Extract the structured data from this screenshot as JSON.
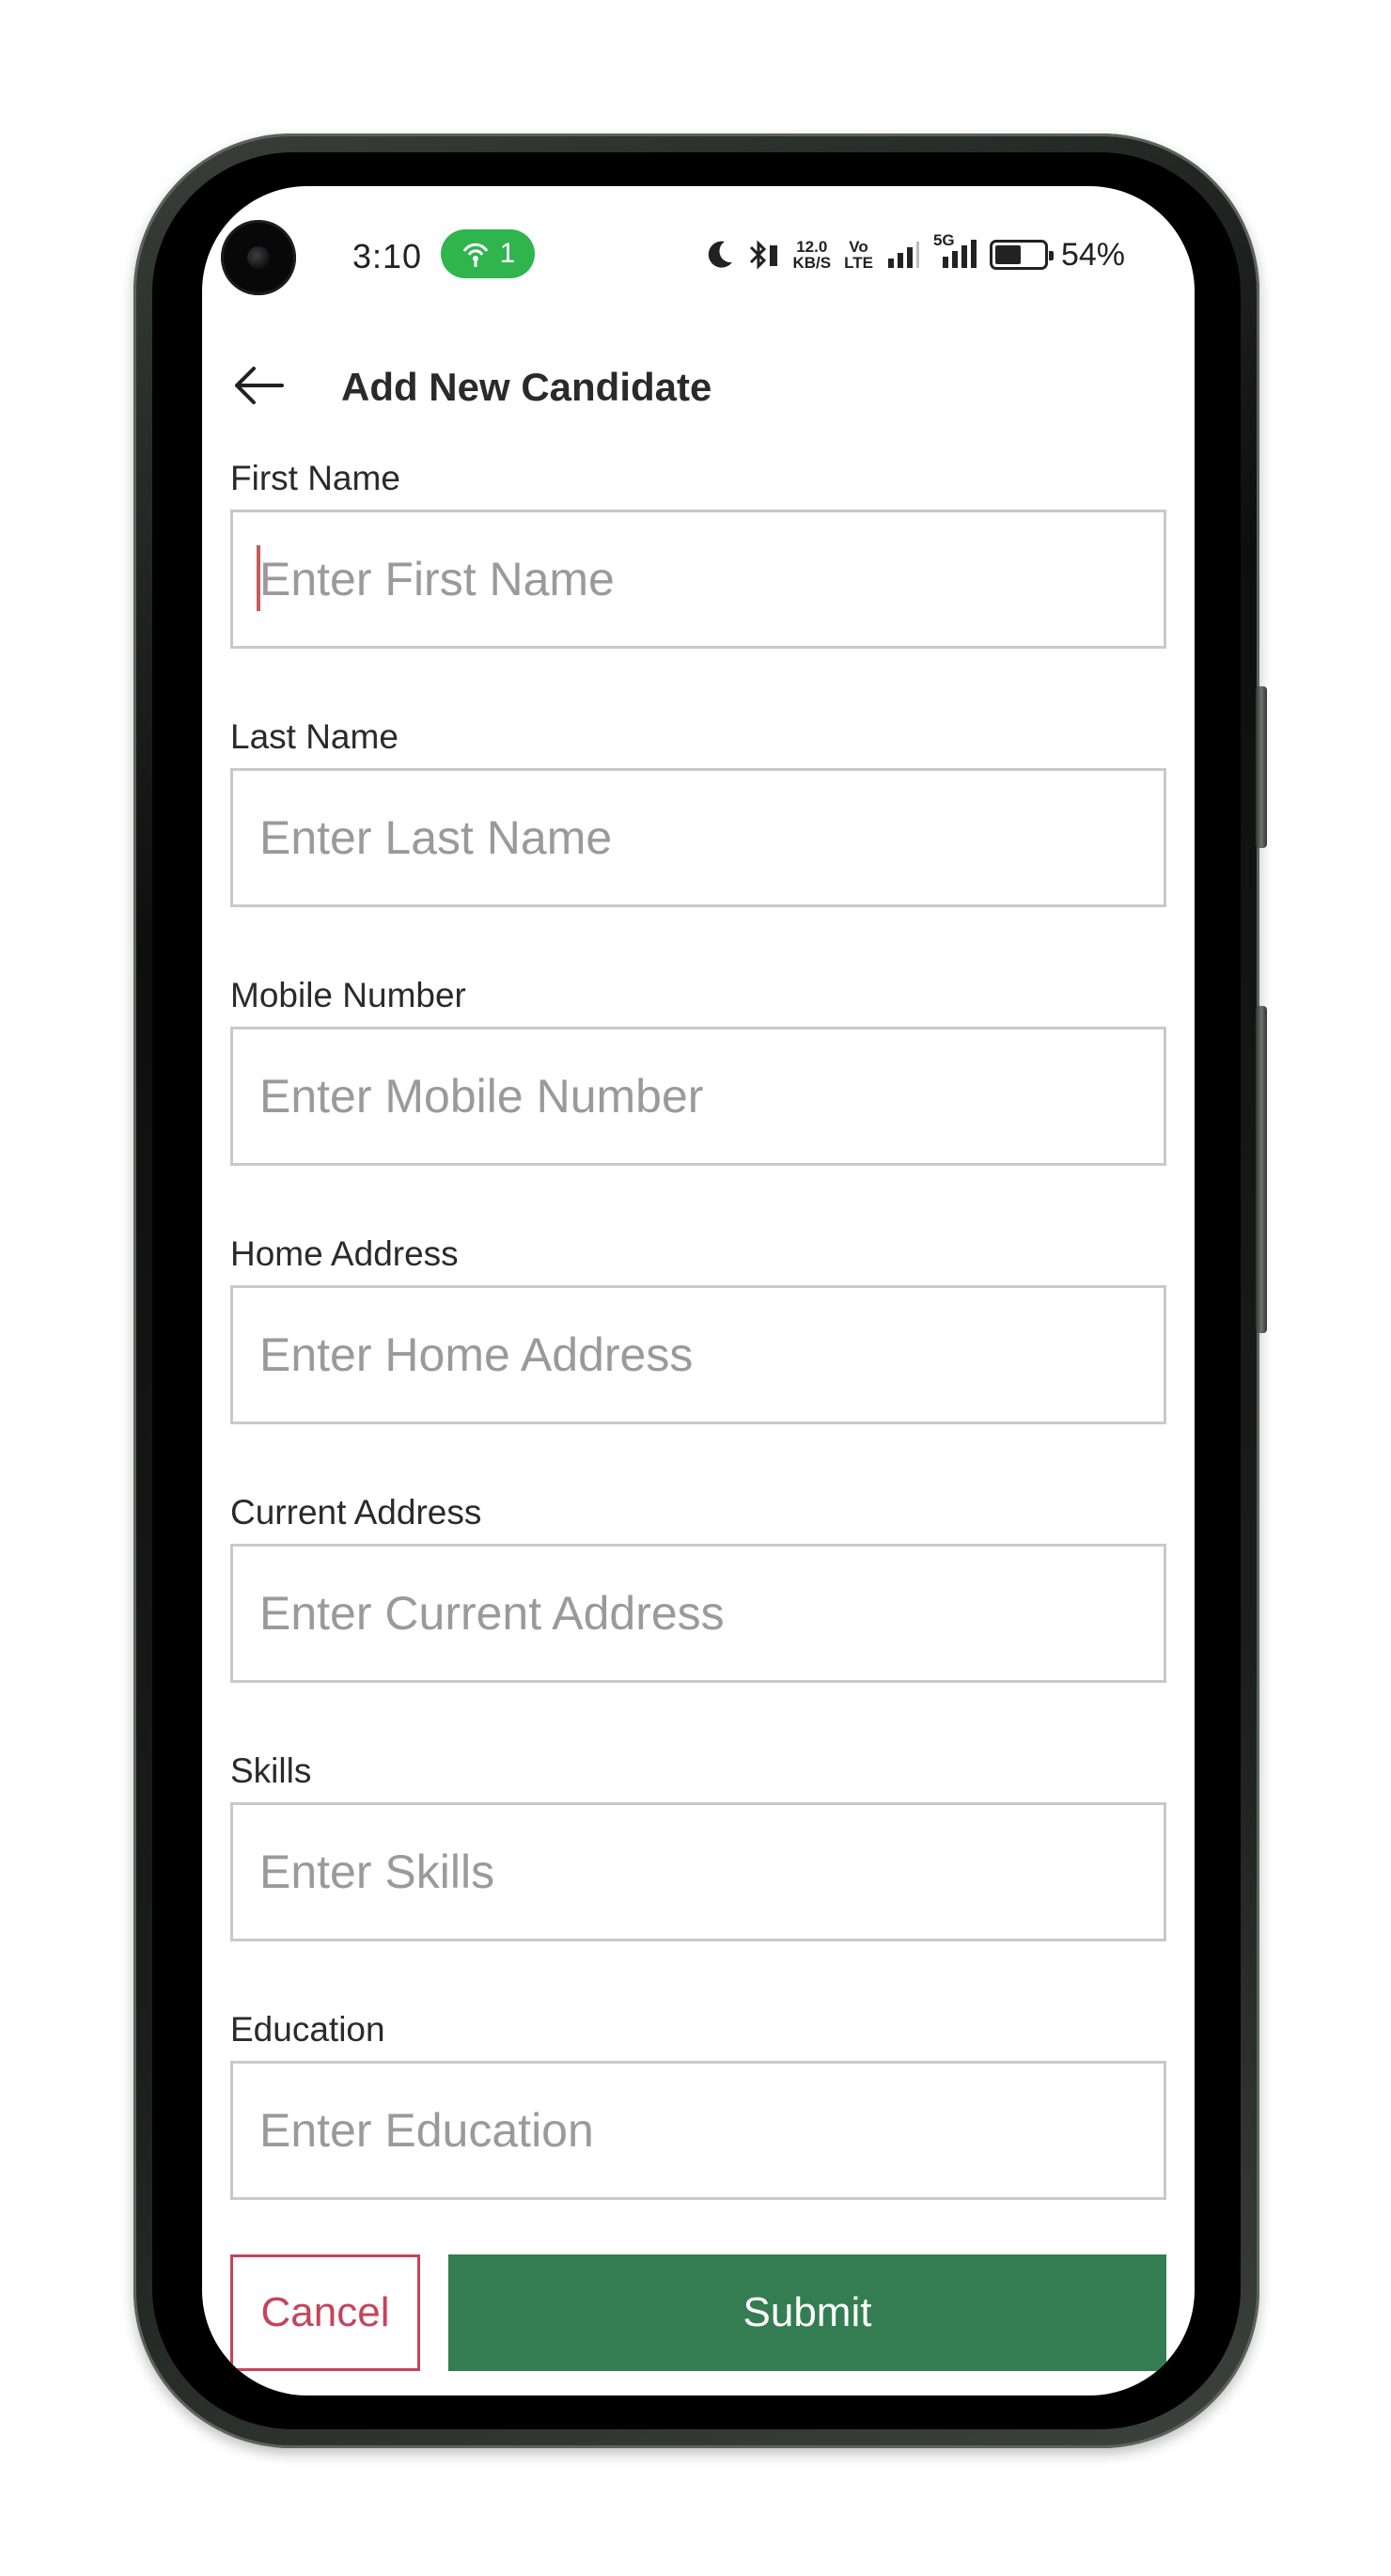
{
  "status_bar": {
    "time": "3:10",
    "hotspot_count": "1",
    "network_speed_value": "12.0",
    "network_speed_unit": "KB/S",
    "volte_top": "Vo",
    "volte_bottom": "LTE",
    "network_type": "5G",
    "battery_percent": "54%",
    "battery_level": 0.54,
    "icons": [
      "camera-icon",
      "hotspot-icon",
      "moon-icon",
      "bluetooth-icon",
      "signal-icon",
      "battery-icon"
    ]
  },
  "app_bar": {
    "title": "Add New Candidate",
    "back_icon": "arrow-left-icon"
  },
  "form": {
    "fields": [
      {
        "label": "First Name",
        "placeholder": "Enter First Name",
        "value": "",
        "focused": true
      },
      {
        "label": "Last Name",
        "placeholder": "Enter Last Name",
        "value": ""
      },
      {
        "label": "Mobile Number",
        "placeholder": "Enter Mobile Number",
        "value": ""
      },
      {
        "label": "Home Address",
        "placeholder": "Enter Home Address",
        "value": ""
      },
      {
        "label": "Current Address",
        "placeholder": "Enter Current Address",
        "value": ""
      },
      {
        "label": "Skills",
        "placeholder": "Enter Skills",
        "value": ""
      },
      {
        "label": "Education",
        "placeholder": "Enter Education",
        "value": ""
      }
    ]
  },
  "actions": {
    "cancel_label": "Cancel",
    "submit_label": "Submit"
  },
  "colors": {
    "accent_green": "#347d52",
    "cancel_red": "#c4445a",
    "hotspot_green": "#2fb44e",
    "caret": "#c85a5a"
  }
}
